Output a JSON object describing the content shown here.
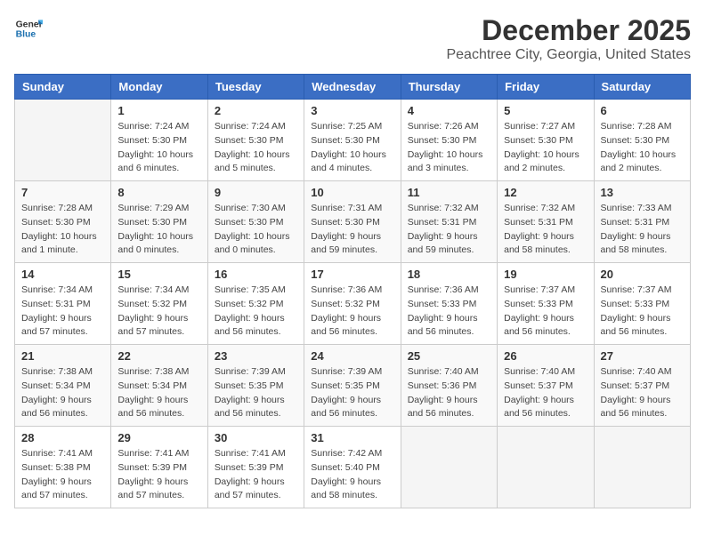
{
  "logo": {
    "line1": "General",
    "line2": "Blue"
  },
  "title": "December 2025",
  "location": "Peachtree City, Georgia, United States",
  "days_of_week": [
    "Sunday",
    "Monday",
    "Tuesday",
    "Wednesday",
    "Thursday",
    "Friday",
    "Saturday"
  ],
  "weeks": [
    [
      {
        "day": "",
        "info": ""
      },
      {
        "day": "1",
        "info": "Sunrise: 7:24 AM\nSunset: 5:30 PM\nDaylight: 10 hours\nand 6 minutes."
      },
      {
        "day": "2",
        "info": "Sunrise: 7:24 AM\nSunset: 5:30 PM\nDaylight: 10 hours\nand 5 minutes."
      },
      {
        "day": "3",
        "info": "Sunrise: 7:25 AM\nSunset: 5:30 PM\nDaylight: 10 hours\nand 4 minutes."
      },
      {
        "day": "4",
        "info": "Sunrise: 7:26 AM\nSunset: 5:30 PM\nDaylight: 10 hours\nand 3 minutes."
      },
      {
        "day": "5",
        "info": "Sunrise: 7:27 AM\nSunset: 5:30 PM\nDaylight: 10 hours\nand 2 minutes."
      },
      {
        "day": "6",
        "info": "Sunrise: 7:28 AM\nSunset: 5:30 PM\nDaylight: 10 hours\nand 2 minutes."
      }
    ],
    [
      {
        "day": "7",
        "info": "Sunrise: 7:28 AM\nSunset: 5:30 PM\nDaylight: 10 hours\nand 1 minute."
      },
      {
        "day": "8",
        "info": "Sunrise: 7:29 AM\nSunset: 5:30 PM\nDaylight: 10 hours\nand 0 minutes."
      },
      {
        "day": "9",
        "info": "Sunrise: 7:30 AM\nSunset: 5:30 PM\nDaylight: 10 hours\nand 0 minutes."
      },
      {
        "day": "10",
        "info": "Sunrise: 7:31 AM\nSunset: 5:30 PM\nDaylight: 9 hours\nand 59 minutes."
      },
      {
        "day": "11",
        "info": "Sunrise: 7:32 AM\nSunset: 5:31 PM\nDaylight: 9 hours\nand 59 minutes."
      },
      {
        "day": "12",
        "info": "Sunrise: 7:32 AM\nSunset: 5:31 PM\nDaylight: 9 hours\nand 58 minutes."
      },
      {
        "day": "13",
        "info": "Sunrise: 7:33 AM\nSunset: 5:31 PM\nDaylight: 9 hours\nand 58 minutes."
      }
    ],
    [
      {
        "day": "14",
        "info": "Sunrise: 7:34 AM\nSunset: 5:31 PM\nDaylight: 9 hours\nand 57 minutes."
      },
      {
        "day": "15",
        "info": "Sunrise: 7:34 AM\nSunset: 5:32 PM\nDaylight: 9 hours\nand 57 minutes."
      },
      {
        "day": "16",
        "info": "Sunrise: 7:35 AM\nSunset: 5:32 PM\nDaylight: 9 hours\nand 56 minutes."
      },
      {
        "day": "17",
        "info": "Sunrise: 7:36 AM\nSunset: 5:32 PM\nDaylight: 9 hours\nand 56 minutes."
      },
      {
        "day": "18",
        "info": "Sunrise: 7:36 AM\nSunset: 5:33 PM\nDaylight: 9 hours\nand 56 minutes."
      },
      {
        "day": "19",
        "info": "Sunrise: 7:37 AM\nSunset: 5:33 PM\nDaylight: 9 hours\nand 56 minutes."
      },
      {
        "day": "20",
        "info": "Sunrise: 7:37 AM\nSunset: 5:33 PM\nDaylight: 9 hours\nand 56 minutes."
      }
    ],
    [
      {
        "day": "21",
        "info": "Sunrise: 7:38 AM\nSunset: 5:34 PM\nDaylight: 9 hours\nand 56 minutes."
      },
      {
        "day": "22",
        "info": "Sunrise: 7:38 AM\nSunset: 5:34 PM\nDaylight: 9 hours\nand 56 minutes."
      },
      {
        "day": "23",
        "info": "Sunrise: 7:39 AM\nSunset: 5:35 PM\nDaylight: 9 hours\nand 56 minutes."
      },
      {
        "day": "24",
        "info": "Sunrise: 7:39 AM\nSunset: 5:35 PM\nDaylight: 9 hours\nand 56 minutes."
      },
      {
        "day": "25",
        "info": "Sunrise: 7:40 AM\nSunset: 5:36 PM\nDaylight: 9 hours\nand 56 minutes."
      },
      {
        "day": "26",
        "info": "Sunrise: 7:40 AM\nSunset: 5:37 PM\nDaylight: 9 hours\nand 56 minutes."
      },
      {
        "day": "27",
        "info": "Sunrise: 7:40 AM\nSunset: 5:37 PM\nDaylight: 9 hours\nand 56 minutes."
      }
    ],
    [
      {
        "day": "28",
        "info": "Sunrise: 7:41 AM\nSunset: 5:38 PM\nDaylight: 9 hours\nand 57 minutes."
      },
      {
        "day": "29",
        "info": "Sunrise: 7:41 AM\nSunset: 5:39 PM\nDaylight: 9 hours\nand 57 minutes."
      },
      {
        "day": "30",
        "info": "Sunrise: 7:41 AM\nSunset: 5:39 PM\nDaylight: 9 hours\nand 57 minutes."
      },
      {
        "day": "31",
        "info": "Sunrise: 7:42 AM\nSunset: 5:40 PM\nDaylight: 9 hours\nand 58 minutes."
      },
      {
        "day": "",
        "info": ""
      },
      {
        "day": "",
        "info": ""
      },
      {
        "day": "",
        "info": ""
      }
    ]
  ]
}
